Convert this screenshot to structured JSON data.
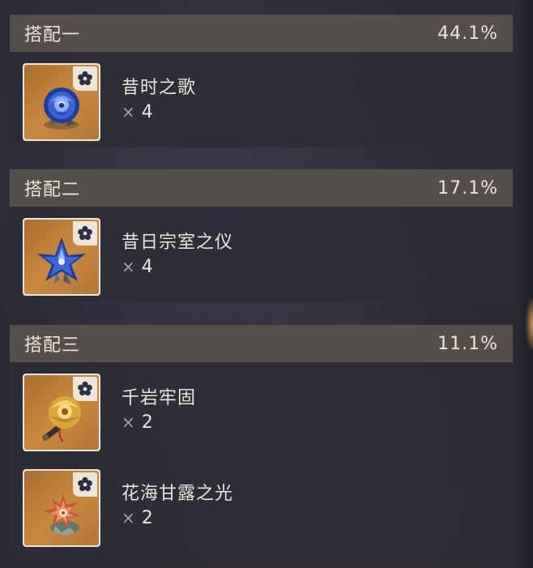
{
  "sets": [
    {
      "label": "搭配一",
      "percent": "44.1%",
      "items": [
        {
          "name": "昔时之歌",
          "multiplier": "×",
          "qty": "4",
          "icon": "blue-rose-flower-icon"
        }
      ]
    },
    {
      "label": "搭配二",
      "percent": "17.1%",
      "items": [
        {
          "name": "昔日宗室之仪",
          "multiplier": "×",
          "qty": "4",
          "icon": "blue-lily-flower-icon"
        }
      ]
    },
    {
      "label": "搭配三",
      "percent": "11.1%",
      "items": [
        {
          "name": "千岩牢固",
          "multiplier": "×",
          "qty": "2",
          "icon": "golden-flower-icon"
        },
        {
          "name": "花海甘露之光",
          "multiplier": "×",
          "qty": "2",
          "icon": "coral-flower-icon"
        }
      ]
    }
  ],
  "colors": {
    "header_bg": "#544f4b",
    "card_frame": "#ece5d8",
    "card_bg": "#c98a3d",
    "text": "#ece5d8",
    "muted": "#a7a39d"
  }
}
